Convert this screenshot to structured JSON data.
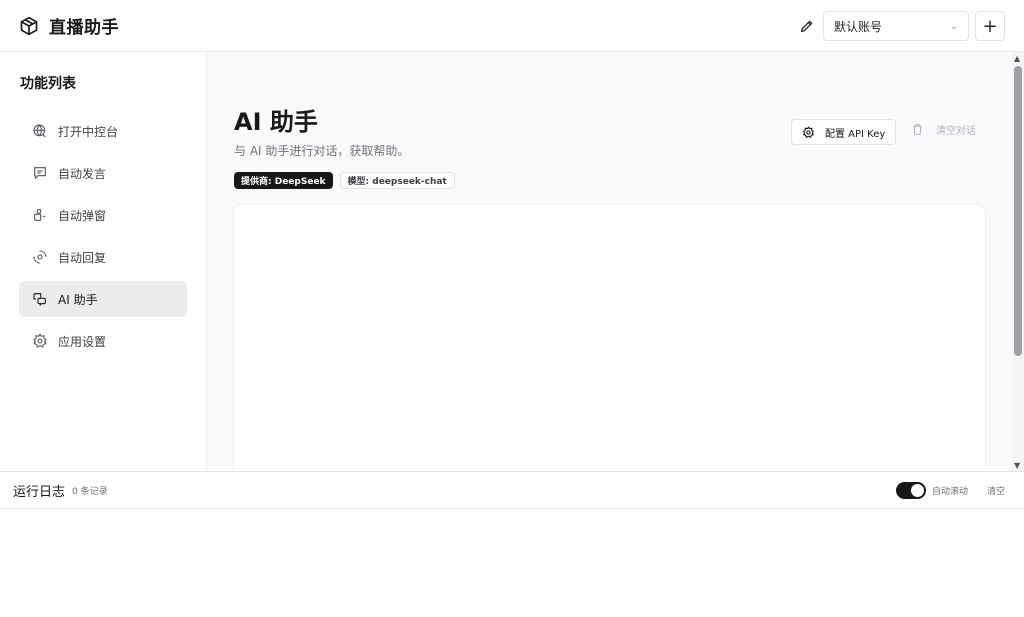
{
  "header": {
    "title": "直播助手",
    "account": "默认账号"
  },
  "sidebar": {
    "title": "功能列表",
    "items": [
      {
        "label": "打开中控台",
        "icon": "globe-icon"
      },
      {
        "label": "自动发言",
        "icon": "message-icon"
      },
      {
        "label": "自动弹窗",
        "icon": "package-icon"
      },
      {
        "label": "自动回复",
        "icon": "reply-icon"
      },
      {
        "label": "AI 助手",
        "icon": "ai-chat-icon",
        "active": true
      },
      {
        "label": "应用设置",
        "icon": "settings-icon"
      }
    ]
  },
  "main": {
    "title": "AI 助手",
    "description": "与 AI 助手进行对话，获取帮助。",
    "provider_badge": "提供商: DeepSeek",
    "model_badge": "模型: deepseek-chat",
    "config_button": "配置 API Key",
    "clear_button": "清空对话"
  },
  "log": {
    "title": "运行日志",
    "count": "0 条记录",
    "auto_scroll": "自动滚动",
    "clear": "清空",
    "auto_scroll_enabled": true
  }
}
